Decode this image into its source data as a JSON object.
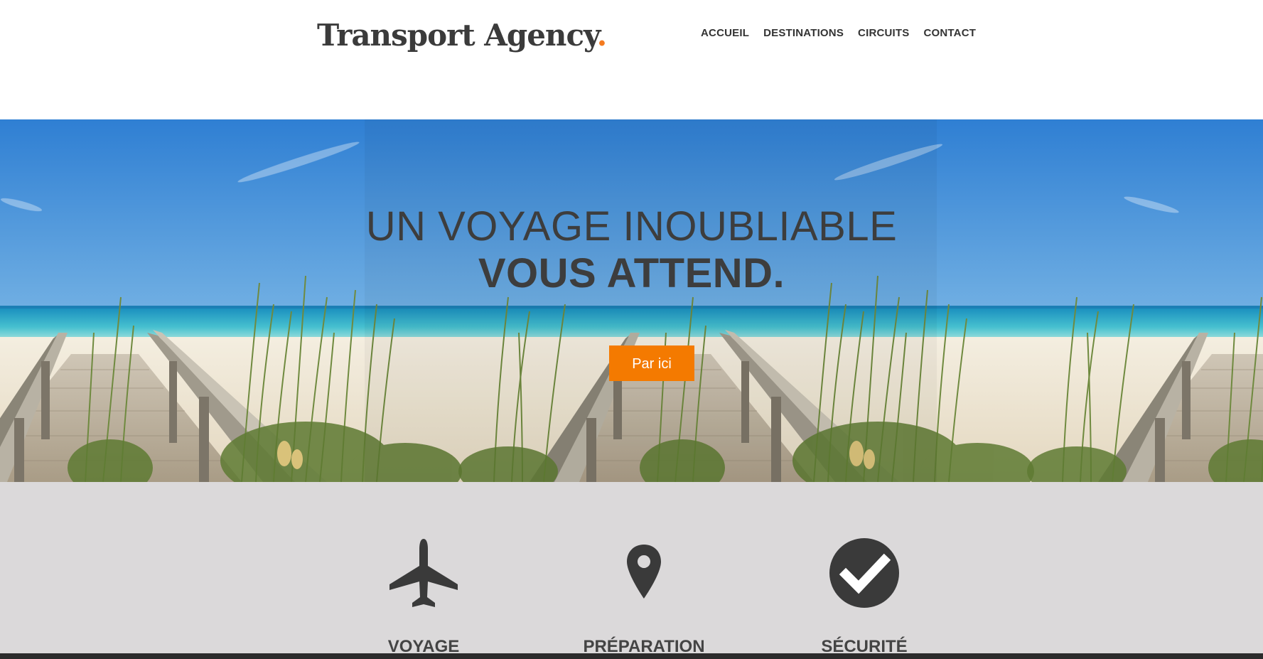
{
  "header": {
    "logo_text": "Transport Agency",
    "logo_dot": ".",
    "nav": [
      "ACCUEIL",
      "DESTINATIONS",
      "CIRCUITS",
      "CONTACT"
    ]
  },
  "hero": {
    "title_line1": "UN VOYAGE INOUBLIABLE",
    "title_line2": "VOUS ATTEND.",
    "cta_label": "Par ici"
  },
  "features": [
    {
      "icon": "airplane-icon",
      "label": "VOYAGE"
    },
    {
      "icon": "map-pin-icon",
      "label": "PRÉPARATION"
    },
    {
      "icon": "check-circle-icon",
      "label": "SÉCURITÉ"
    }
  ],
  "colors": {
    "accent": "#f47a00",
    "text_dark": "#3d3d3d",
    "features_bg": "#dbd9da"
  }
}
